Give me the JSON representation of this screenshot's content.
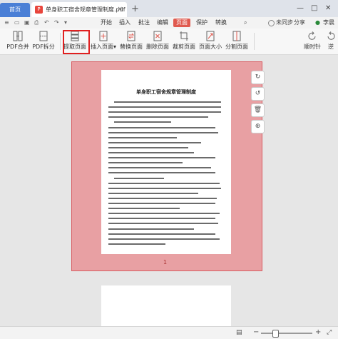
{
  "titlebar": {
    "home_tab": "首页",
    "doc_tab": "单身职工宿舍规章管理制度.pdf",
    "pdf_badge": "P",
    "close_glyph": "×",
    "new_tab_glyph": "+",
    "minimize_glyph": "—",
    "maximize_glyph": "□",
    "window_close_glyph": "✕"
  },
  "menubar": {
    "items": [
      "开始",
      "插入",
      "批注",
      "编辑",
      "页面",
      "保护",
      "转换"
    ],
    "active_index": 4,
    "unsynced": "未同步",
    "share": "分享",
    "user": "李晨"
  },
  "toolbar": {
    "tools": [
      {
        "label": "PDF合并",
        "icon": "merge-icon"
      },
      {
        "label": "PDF拆分",
        "icon": "split-icon"
      },
      {
        "label": "提取页面",
        "icon": "extract-page-icon"
      },
      {
        "label": "插入页面",
        "icon": "insert-page-icon"
      },
      {
        "label": "替换页面",
        "icon": "replace-page-icon"
      },
      {
        "label": "删除页面",
        "icon": "delete-page-icon"
      },
      {
        "label": "裁剪页面",
        "icon": "crop-page-icon"
      },
      {
        "label": "页面大小",
        "icon": "page-size-icon"
      },
      {
        "label": "分割页面",
        "icon": "divide-page-icon"
      },
      {
        "label": "顺时针",
        "icon": "rotate-cw-icon"
      },
      {
        "label": "逆",
        "icon": "rotate-ccw-icon"
      }
    ],
    "page_select_value": "1",
    "insert_dropdown_glyph": "▾",
    "select_arrow_glyph": "▼"
  },
  "document": {
    "title": "单身职工宿舍规章管理制度",
    "page_number": "1"
  },
  "colors": {
    "accent": "#e05a4f",
    "selection_bg": "#e8a0a3",
    "home_tab": "#4a7fd6",
    "highlight_box": "#e01f1f"
  }
}
